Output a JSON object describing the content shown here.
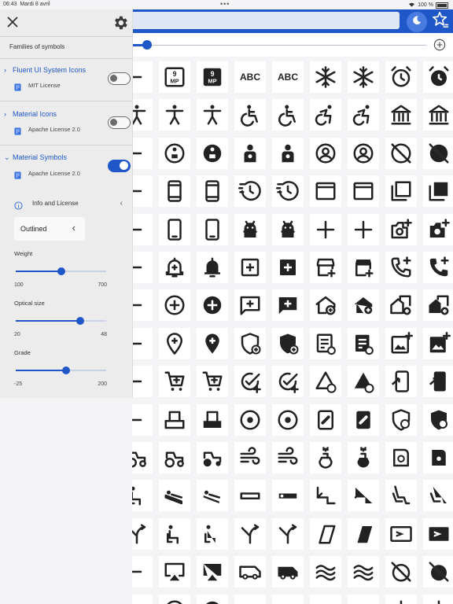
{
  "status": {
    "time": "06:43",
    "date": "Mardi 8 avril",
    "battery": "100 %"
  },
  "drawer": {
    "families_heading": "Families of symbols",
    "families": [
      {
        "name": "Fluent UI System Icons",
        "license": "MIT License",
        "enabled": false,
        "expanded": false
      },
      {
        "name": "Material Icons",
        "license": "Apache License 2.0",
        "enabled": false,
        "expanded": false
      },
      {
        "name": "Material Symbols",
        "license": "Apache License 2.0",
        "enabled": true,
        "expanded": true
      }
    ],
    "info_label": "Info and License",
    "style_value": "Outlined",
    "weight": {
      "label": "Weight",
      "min": "100",
      "max": "700",
      "value": 400,
      "range": [
        100,
        700
      ]
    },
    "optical_size": {
      "label": "Optical size",
      "min": "20",
      "max": "48",
      "value": 40,
      "range": [
        20,
        48
      ]
    },
    "grade": {
      "label": "Grade",
      "min": "-25",
      "max": "200",
      "value": 100,
      "range": [
        -25,
        200
      ]
    }
  },
  "toolbar": {
    "size_slider_value": 0.03
  },
  "icon_grid": {
    "columns": 9,
    "rows": [
      [
        "keypad-partial-icon",
        "txt:9 MP outline",
        "txt:9 MP filled",
        "txt:ABC",
        "txt:ABC",
        "ac-unit-icon",
        "ac-unit-icon",
        "alarm-icon",
        "alarm-filled-icon"
      ],
      [
        "accessibility-partial-icon",
        "accessibility-icon",
        "accessibility-icon",
        "accessible-icon",
        "accessible-icon",
        "accessible-forward-icon",
        "accessible-forward-icon",
        "account-balance-icon",
        "account-balance-icon"
      ],
      [
        "account-box-partial-icon",
        "account-child-icon",
        "account-child-filled-icon",
        "account-child-invert-icon",
        "account-child-invert-icon",
        "account-circle-icon",
        "account-circle-icon",
        "account-circle-off-icon",
        "account-circle-off-filled-icon"
      ],
      [
        "account-tree-partial-icon",
        "ad-units-icon",
        "ad-units-icon",
        "manage-history-icon",
        "manage-history-filled-icon",
        "web-asset-icon",
        "web-asset-icon",
        "library-icon",
        "library-filled-icon"
      ],
      [
        "phone-off-partial-icon",
        "phone-android-icon",
        "phone-android-icon",
        "android-icon",
        "android-icon",
        "add-icon",
        "add-icon",
        "add-a-photo-icon",
        "add-a-photo-filled-icon"
      ],
      [
        "add-alarm-partial-icon",
        "add-alert-icon",
        "add-alert-filled-icon",
        "add-box-icon",
        "add-box-filled-icon",
        "add-business-icon",
        "add-business-filled-icon",
        "add-call-icon",
        "add-call-filled-icon"
      ],
      [
        "add-card-partial-icon",
        "add-circle-icon",
        "add-circle-filled-icon",
        "add-comment-icon",
        "add-comment-filled-icon",
        "add-home-icon",
        "add-home-filled-icon",
        "add-home-work-icon",
        "add-home-work-filled-icon"
      ],
      [
        "add-link-partial-icon",
        "add-location-icon",
        "add-location-filled-icon",
        "add-moderator-icon",
        "add-moderator-filled-icon",
        "add-notes-icon",
        "add-notes-filled-icon",
        "add-photo-icon",
        "add-photo-filled-icon"
      ],
      [
        "playlist-add-partial-icon",
        "add-shopping-cart-icon",
        "add-shopping-cart-icon",
        "add-task-icon",
        "add-task-icon",
        "add-triangle-icon",
        "add-triangle-filled-icon",
        "add-to-mobile-icon",
        "add-to-mobile-filled-icon"
      ],
      [
        "add-to-queue-partial-icon",
        "adf-scanner-icon",
        "adf-scanner-filled-icon",
        "adjust-icon",
        "adjust-filled-icon",
        "admin-meds-icon",
        "admin-meds-filled-icon",
        "admin-panel-icon",
        "admin-panel-filled-icon"
      ],
      [
        "agriculture-partial-icon",
        "agriculture-icon",
        "agriculture-filled-icon",
        "air-icon",
        "air-icon",
        "air-freshener-icon",
        "air-freshener-filled-icon",
        "air-purifier-icon",
        "air-purifier-filled-icon"
      ],
      [
        "airline-seat-partial-icon",
        "seat-flat-angled-icon",
        "seat-flat-angled-filled-icon",
        "seat-flat-icon",
        "seat-flat-filled-icon",
        "seat-legroom-icon",
        "seat-legroom-filled-icon",
        "seat-recline-icon",
        "seat-recline-filled-icon"
      ],
      [
        "airline-stops-partial-icon",
        "airline-seat-icon",
        "airline-seat-filled-icon",
        "airline-stops-icon",
        "airline-stops-icon",
        "airlines-icon",
        "airlines-filled-icon",
        "airplane-ticket-icon",
        "airplane-ticket-filled-icon"
      ],
      [
        "airplanemode-partial-icon",
        "airplay-icon",
        "airplay-filled-icon",
        "airport-shuttle-icon",
        "airport-shuttle-filled-icon",
        "airwave-icon",
        "airwave-icon",
        "alarm-off-icon",
        "alarm-off-filled-icon"
      ],
      [
        "partial-icon",
        "album-icon",
        "album-filled-icon",
        "align-center-icon",
        "align-center-icon",
        "align-bottom-icon",
        "align-bottom-icon",
        "align-vertical-icon",
        "align-vertical-icon"
      ]
    ]
  }
}
